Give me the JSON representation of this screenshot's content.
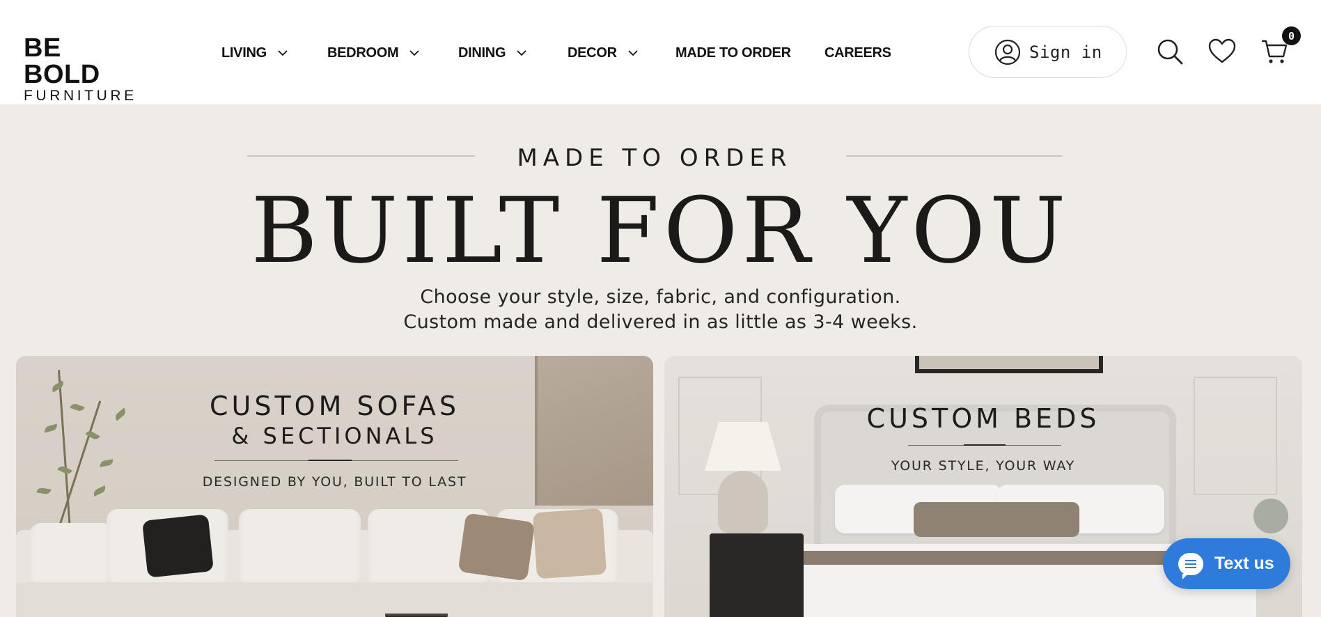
{
  "brand": {
    "line1": "BE BOLD",
    "line2": "FURNITURE"
  },
  "nav": {
    "items": [
      {
        "label": "LIVING",
        "has_menu": true
      },
      {
        "label": "BEDROOM",
        "has_menu": true
      },
      {
        "label": "DINING",
        "has_menu": true
      },
      {
        "label": "DECOR",
        "has_menu": true
      },
      {
        "label": "MADE TO ORDER",
        "has_menu": false
      },
      {
        "label": "CAREERS",
        "has_menu": false
      }
    ]
  },
  "header_actions": {
    "sign_in_label": "Sign in",
    "user_icon": "user-circle-icon",
    "search_icon": "search-icon",
    "wishlist_icon": "heart-icon",
    "cart_icon": "cart-icon",
    "cart_count": "0"
  },
  "hero": {
    "eyebrow": "MADE TO ORDER",
    "headline": "BUILT FOR YOU",
    "subline1": "Choose your style, size, fabric, and configuration.",
    "subline2": "Custom made and delivered in as little as 3-4 weeks.",
    "background": "#efebe6"
  },
  "cards": {
    "sofas": {
      "title1": "CUSTOM SOFAS",
      "title2": "& SECTIONALS",
      "tagline": "DESIGNED BY YOU, BUILT TO LAST"
    },
    "beds": {
      "title": "CUSTOM BEDS",
      "tagline": "YOUR STYLE, YOUR WAY"
    }
  },
  "chat": {
    "label": "Text us",
    "icon": "chat-bubble-icon",
    "color": "#2f7bdc"
  }
}
